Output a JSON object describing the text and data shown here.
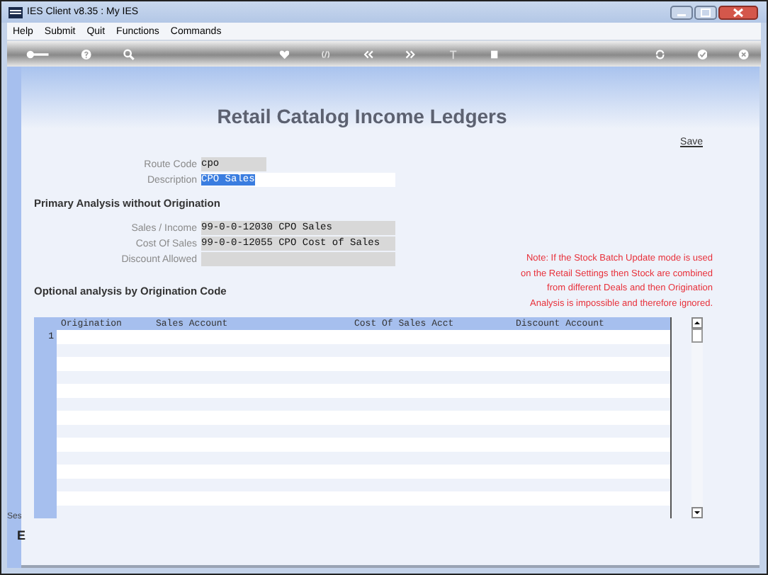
{
  "window": {
    "title": "IES Client v8.35 : My IES"
  },
  "menu": [
    "Help",
    "Submit",
    "Quit",
    "Functions",
    "Commands"
  ],
  "page": {
    "title": "Retail Catalog Income Ledgers",
    "save_link": "Save"
  },
  "header_fields": [
    {
      "label": "Route Code",
      "value": "cpo",
      "editable": false,
      "highlighted": false
    },
    {
      "label": "Description",
      "value": "CPO Sales",
      "editable": true,
      "highlighted": true
    }
  ],
  "primary": {
    "heading": "Primary Analysis without Origination",
    "fields": [
      {
        "label": "Sales / Income",
        "value": "99-0-0-12030 CPO Sales",
        "editable": false
      },
      {
        "label": "Cost Of Sales",
        "value": "99-0-0-12055 CPO Cost of Sales",
        "editable": false
      },
      {
        "label": "Discount Allowed",
        "editable": false
      }
    ]
  },
  "note": "Note: If the Stock Batch Update mode is used\non the Retail Settings then Stock are combined\nfrom different Deals and then Origination\nAnalysis is impossible and therefore ignored.",
  "optional": {
    "heading": "Optional analysis by Origination Code"
  },
  "grid": {
    "columns": [
      "Origination",
      "Sales Account",
      "Cost Of Sales Acct",
      "Discount Account"
    ],
    "rows": [
      {
        "number": "1"
      }
    ]
  },
  "side_strip": {
    "label": "Ses",
    "key": "E"
  }
}
